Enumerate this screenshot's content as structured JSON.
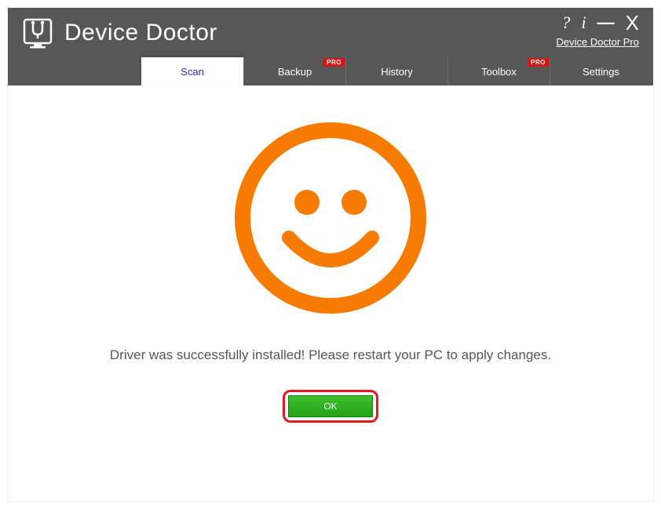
{
  "header": {
    "app_title": "Device Doctor",
    "pro_link": "Device Doctor Pro",
    "help_glyph": "?",
    "info_glyph": "i",
    "minimize_glyph": "—",
    "close_glyph": "X"
  },
  "tabs": {
    "scan": {
      "label": "Scan",
      "active": true
    },
    "backup": {
      "label": "Backup",
      "pro": "PRO"
    },
    "history": {
      "label": "History"
    },
    "toolbox": {
      "label": "Toolbox",
      "pro": "PRO"
    },
    "settings": {
      "label": "Settings"
    }
  },
  "main": {
    "status_message": "Driver was successfully installed! Please restart your PC to apply changes.",
    "ok_label": "OK"
  },
  "colors": {
    "accent_orange": "#F77B00",
    "header_grey": "#575757",
    "ok_green": "#2FAE20",
    "highlight_red": "#E4191E"
  }
}
